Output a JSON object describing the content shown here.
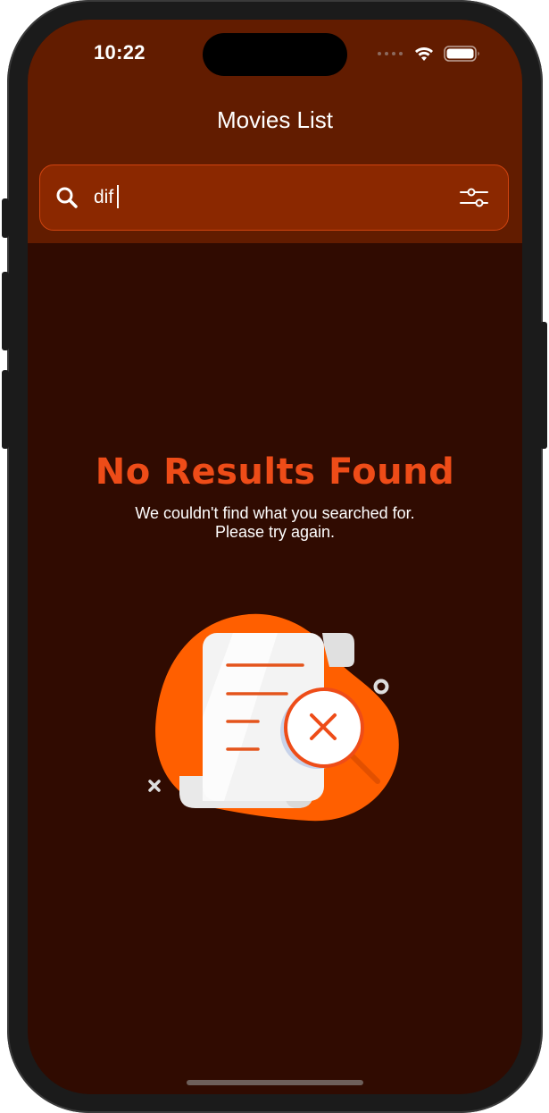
{
  "status_bar": {
    "time": "10:22",
    "icons": [
      "signal-dots-icon",
      "wifi-icon",
      "battery-icon"
    ]
  },
  "header": {
    "title": "Movies List"
  },
  "search": {
    "value": "dif",
    "placeholder": "",
    "icon": "search-icon",
    "filter_icon": "filter-sliders-icon"
  },
  "empty_state": {
    "title": "No Results Found",
    "line1": "We couldn't find what you searched for.",
    "line2": "Please try again.",
    "illustration": "no-results-document-magnifier-illustration"
  },
  "colors": {
    "header_bg": "#621c00",
    "screen_bg": "#300b01",
    "search_bg": "#8b2800",
    "accent": "#ee4c18",
    "illustration_orange": "#ff5f00"
  }
}
